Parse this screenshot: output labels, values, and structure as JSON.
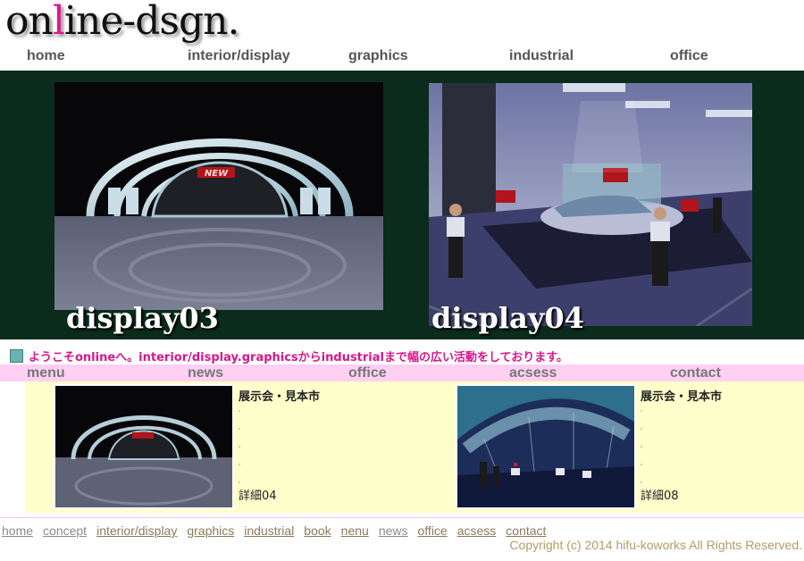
{
  "logo": {
    "before": "on",
    "accent": "l",
    "after": "ine-dsgn."
  },
  "top_nav": [
    "home",
    "interior/display",
    "graphics",
    "industrial",
    "office"
  ],
  "hero": [
    {
      "caption": "display03",
      "badge": "NEW"
    },
    {
      "caption": "display04"
    }
  ],
  "welcome": "ようこそonlineへ。interior/display.graphicsからindustrialまで幅の広い活動をしております。",
  "sub_nav": [
    "menu",
    "news",
    "office",
    "acsess",
    "contact"
  ],
  "cards": [
    {
      "title": "展示会・見本市",
      "detail": "詳細04"
    },
    {
      "title": "展示会・見本市",
      "detail": "詳細08"
    }
  ],
  "footer_nav": [
    "home",
    "concept",
    "interior/display",
    "graphics",
    "industrial",
    "book",
    "nenu",
    "news",
    "office",
    "acsess",
    "contact"
  ],
  "copyright": "Copyright (c) 2014 hifu-koworks All Rights Reserved.",
  "colors": {
    "accent_pink": "#e0188c",
    "hero_bg": "#0b2b1d",
    "subnav_bg": "#ffd0f3",
    "panel_bg": "#ffffcc",
    "welcome_text": "#d9158a"
  }
}
